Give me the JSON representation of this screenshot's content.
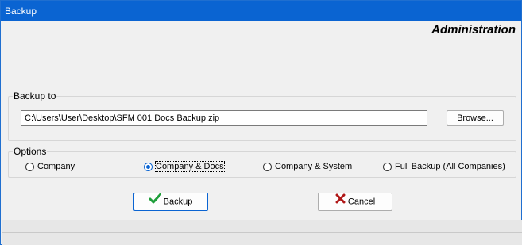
{
  "window": {
    "title": "Backup"
  },
  "header": {
    "section": "Administration"
  },
  "backup_to": {
    "label": "Backup to",
    "path": "C:\\Users\\User\\Desktop\\SFM 001 Docs Backup.zip",
    "browse_label": "Browse..."
  },
  "options": {
    "label": "Options",
    "items": [
      {
        "label": "Company",
        "selected": false
      },
      {
        "label": "Company & Docs",
        "selected": true
      },
      {
        "label": "Company & System",
        "selected": false
      },
      {
        "label": "Full Backup (All Companies)",
        "selected": false
      }
    ]
  },
  "actions": {
    "backup_label": "Backup",
    "cancel_label": "Cancel"
  },
  "colors": {
    "titlebar": "#0a64d2",
    "checkmark": "#1e9e3a",
    "cancel_x": "#b01818"
  },
  "icons": {
    "backup": "checkmark-icon",
    "cancel": "x-icon"
  }
}
